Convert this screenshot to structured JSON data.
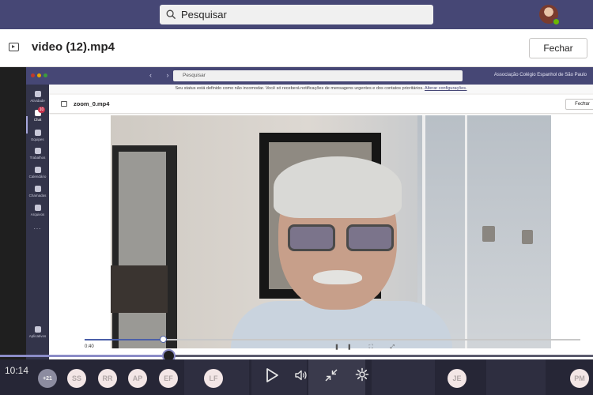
{
  "outer": {
    "search_placeholder": "Pesquisar",
    "file_title": "video (12).mp4",
    "close_label": "Fechar",
    "current_time": "10:14",
    "progress": 0.285
  },
  "inner": {
    "search_placeholder": "Pesquisar",
    "org_name": "Associação Colégio Espanhol de São Paulo",
    "status_text": "Seu status está definido como não incomodar. Você só receberá notificações de mensagens urgentes e dos contatos prioritários.",
    "status_link": "Alterar configurações.",
    "file_title": "zoom_0.mp4",
    "close_label": "Fechar",
    "time": "0:40",
    "progress": 0.16,
    "rail": [
      {
        "label": "Atividade",
        "icon": "bell-icon"
      },
      {
        "label": "Chat",
        "icon": "chat-icon",
        "badge": "10"
      },
      {
        "label": "Equipes",
        "icon": "teams-icon"
      },
      {
        "label": "Trabalhos",
        "icon": "assignments-icon"
      },
      {
        "label": "Calendário",
        "icon": "calendar-icon"
      },
      {
        "label": "Chamadas",
        "icon": "phone-icon"
      },
      {
        "label": "Arquivos",
        "icon": "files-icon"
      },
      {
        "label": "...",
        "icon": "more-icon"
      },
      {
        "label": "Aplicativos",
        "icon": "apps-icon"
      }
    ]
  },
  "participants": {
    "overflow_count": "+21",
    "chips": [
      {
        "initials": "SS"
      },
      {
        "initials": "RR"
      },
      {
        "initials": "AP"
      },
      {
        "initials": "EF"
      },
      {
        "initials": "LF"
      },
      {
        "initials": "JE"
      },
      {
        "initials": "PM"
      }
    ]
  },
  "colors": {
    "teams_purple": "#464775",
    "accent": "#8b8cc7",
    "presence_available": "#6bb700"
  }
}
